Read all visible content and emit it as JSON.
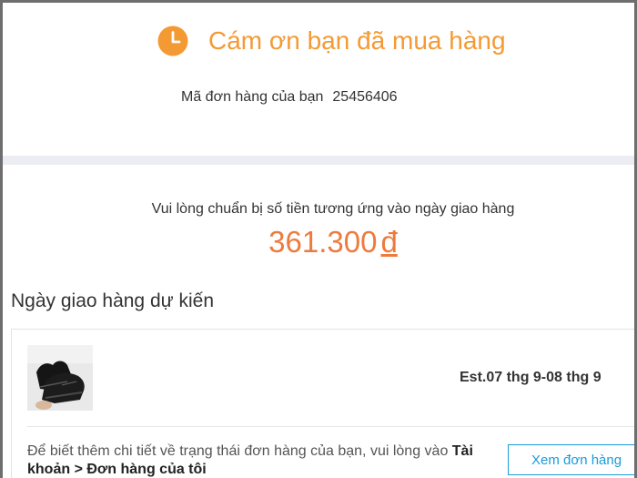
{
  "header": {
    "icon": "clock-icon",
    "title": "Cám ơn bạn đã mua hàng",
    "accent_color": "#f39a34"
  },
  "order": {
    "label": "Mã đơn hàng của bạn",
    "number": "25456406"
  },
  "payment": {
    "instruction": "Vui lòng chuẩn bị số tiền tương ứng vào ngày giao hàng",
    "amount": "361.300",
    "currency": "đ",
    "amount_color": "#ee7a3c"
  },
  "delivery": {
    "heading": "Ngày giao hàng dự kiến",
    "product_image": "black-sneakers-photo",
    "estimate": "Est.07 thg 9-08 thg 9",
    "info_prefix": "Để biết thêm chi tiết về trạng thái đơn hàng của bạn, vui lòng vào ",
    "info_link": "Tài khoản > Đơn hàng của tôi",
    "view_order_label": "Xem đơn hàng",
    "button_color": "#1a9cd8"
  }
}
